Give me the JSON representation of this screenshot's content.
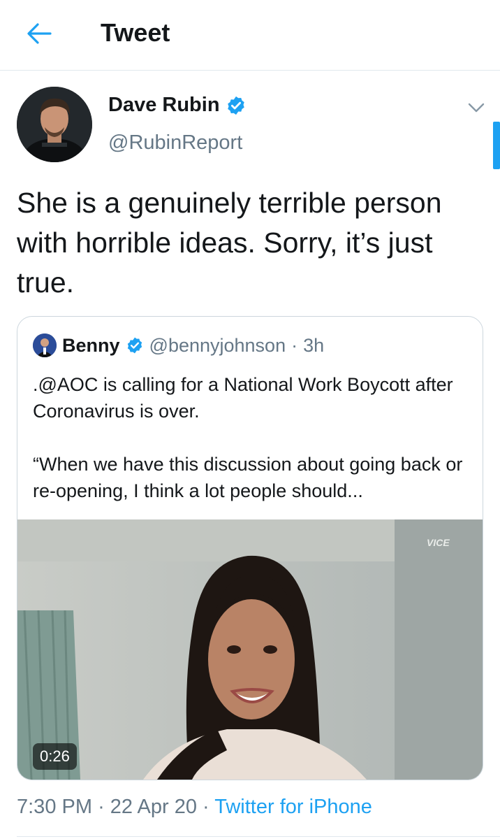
{
  "header": {
    "title": "Tweet",
    "back_icon": "arrow-left-icon"
  },
  "tweet": {
    "author_name": "Dave Rubin",
    "author_handle": "@RubinReport",
    "verified": true,
    "text": "She is a genuinely terrible person with horrible ideas. Sorry, it’s just true.",
    "time": "7:30 PM",
    "date": "22 Apr 20",
    "source": "Twitter for iPhone",
    "separator": "·"
  },
  "quoted": {
    "author_name": "Benny",
    "author_handle": "@bennyjohnson",
    "age": "3h",
    "separator": "·",
    "verified": true,
    "paragraph1": ".@AOC is calling for a National Work Boycott after Coronavirus is over.",
    "paragraph2": "“When we have this discussion about going back or re-opening, I think a lot people should...",
    "video_duration": "0:26",
    "watermark": "VICE"
  },
  "colors": {
    "accent": "#1da1f2",
    "secondary_text": "#657786",
    "border": "#ccd6dd"
  }
}
